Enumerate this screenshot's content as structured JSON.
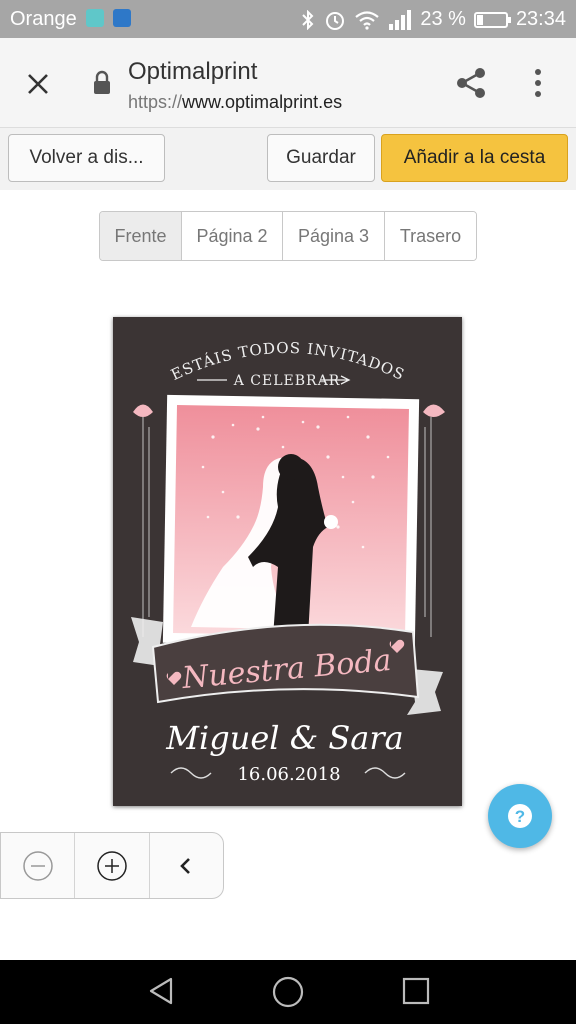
{
  "status_bar": {
    "carrier": "Orange",
    "battery_percent": "23 %",
    "battery_level": 0.23,
    "time": "23:34"
  },
  "browser": {
    "site_title": "Optimalprint",
    "url_scheme": "https://",
    "url_host": "www.optimalprint.es"
  },
  "toolbar": {
    "back_label": "Volver a dis...",
    "save_label": "Guardar",
    "add_to_cart_label": "Añadir a la cesta",
    "accent_color": "#f5c33f"
  },
  "page_tabs": [
    {
      "label": "Frente",
      "active": true
    },
    {
      "label": "Página 2",
      "active": false
    },
    {
      "label": "Página 3",
      "active": false
    },
    {
      "label": "Trasero",
      "active": false
    }
  ],
  "card": {
    "top_line": "ESTÁIS TODOS INVITADOS",
    "second_line": "A CELEBRAR",
    "banner_text": "Nuestra Boda",
    "names": "Miguel & Sara",
    "date": "16.06.2018",
    "background_color": "#3b3434",
    "photo_color": "#f1a1ab"
  },
  "zoom_controls": {
    "icons": [
      "zoom-out-icon",
      "zoom-in-icon",
      "collapse-icon"
    ]
  },
  "help_button": {
    "symbol": "?",
    "color": "#4fb8e6"
  }
}
